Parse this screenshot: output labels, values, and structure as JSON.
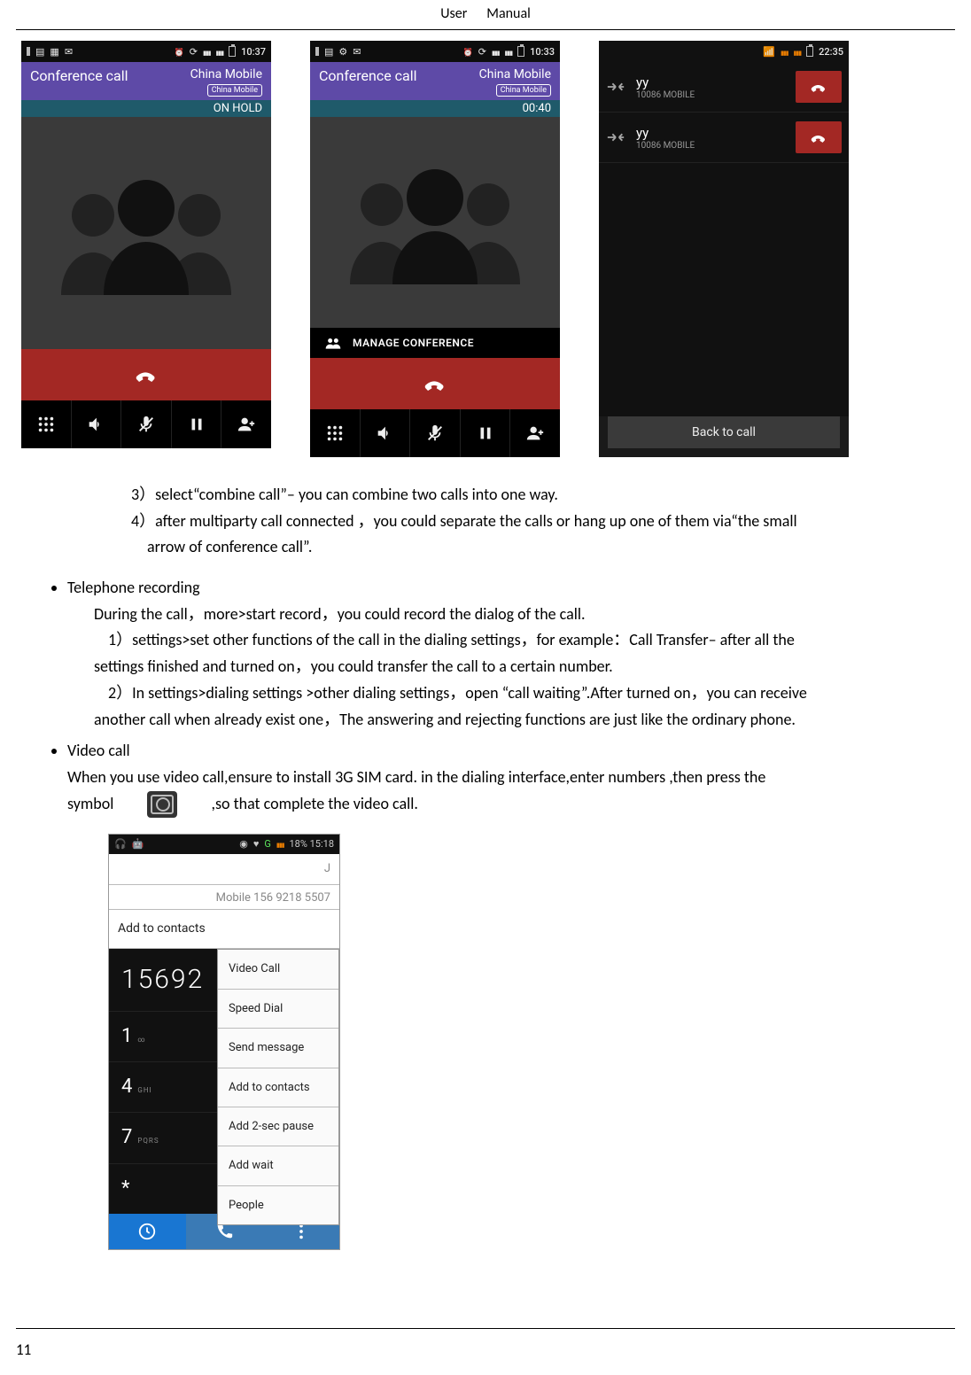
{
  "pageHeader": {
    "w1": "User",
    "w2": "Manual"
  },
  "pageNumber": "11",
  "phone1": {
    "statusTime": "10:37",
    "confTitle": "Conference call",
    "carrier": "China Mobile",
    "carrierPill": "China Mobile",
    "statusStrip": "ON HOLD"
  },
  "phone2": {
    "statusTime": "10:33",
    "confTitle": "Conference call",
    "carrier": "China Mobile",
    "carrierPill": "China Mobile",
    "statusStrip": "00:40",
    "manageLabel": "MANAGE CONFERENCE"
  },
  "phone3": {
    "statusTime": "22:35",
    "rows": [
      {
        "name": "yy",
        "sub": "10086  MOBILE"
      },
      {
        "name": "yy",
        "sub": "10086  MOBILE"
      }
    ],
    "backLabel": "Back to call"
  },
  "step3": "3）select“combine call”– you can combine two calls into one way.",
  "step4a": "4）after multiparty call connected ，you could separate the calls or hang up one of them via“the small",
  "step4b": "arrow of conference call”.",
  "rec_h": "Telephone recording",
  "rec_p1": "During the call，more>start record，you could record the dialog of the call.",
  "rec_p2a": "1）settings>set other functions of the call in the dialing settings，for example：Call Transfer– after all the",
  "rec_p2b": "settings finished and turned on，you could transfer the call to a certain number.",
  "rec_p3a": "2）In settings>dialing settings >other dialing settings，open “call waiting”.After turned on，you can receive",
  "rec_p3b": "another call when already exist one，The answering and rejecting functions are just like the ordinary phone.",
  "video_h": "Video call",
  "video_p1": "When you use video call,ensure to install 3G SIM card. in the dialing interface,enter numbers ,then press the",
  "video_p2a": "symbol",
  "video_p2b": ",so that complete the video call.",
  "dialer": {
    "statusRight": "18% 15:18",
    "nameField": "J",
    "numField": "Mobile 156 9218 5507",
    "addContacts": "Add to contacts",
    "entered": "15692",
    "keys": {
      "k1": "1",
      "k1s": "∞",
      "k4": "4",
      "k4s": "GHI",
      "k7": "7",
      "k7s": "PQRS",
      "kstar": "*"
    },
    "popup": [
      "Video Call",
      "Speed Dial",
      "Send message",
      "Add to contacts",
      "Add 2-sec pause",
      "Add wait",
      "People"
    ]
  }
}
